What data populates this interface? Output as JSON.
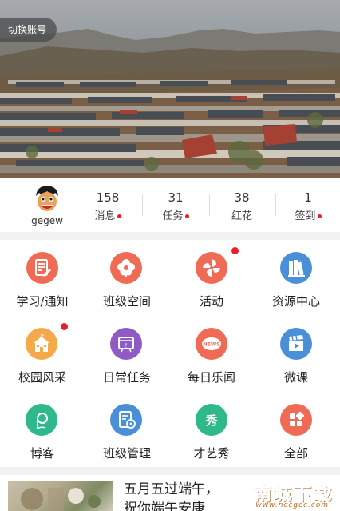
{
  "header": {
    "switch_account_label": "切换账号"
  },
  "profile": {
    "username": "gegew"
  },
  "stats": [
    {
      "count": "158",
      "label": "消息",
      "has_dot": true
    },
    {
      "count": "31",
      "label": "任务",
      "has_dot": true
    },
    {
      "count": "38",
      "label": "红花",
      "has_dot": false
    },
    {
      "count": "1",
      "label": "签到",
      "has_dot": true
    }
  ],
  "grid": {
    "items": [
      {
        "label": "学习/通知",
        "icon": "notice-icon",
        "color": "#f06b55",
        "badge": false
      },
      {
        "label": "班级空间",
        "icon": "flower-icon",
        "color": "#f06b55",
        "badge": false
      },
      {
        "label": "活动",
        "icon": "pinwheel-icon",
        "color": "#f06b55",
        "badge": true
      },
      {
        "label": "资源中心",
        "icon": "books-icon",
        "color": "#4a90d9",
        "badge": false
      },
      {
        "label": "校园风采",
        "icon": "school-icon",
        "color": "#f5a94a",
        "badge": true
      },
      {
        "label": "日常任务",
        "icon": "task-icon",
        "color": "#8e5bc4",
        "badge": false
      },
      {
        "label": "每日乐闻",
        "icon": "news-icon",
        "color": "#f06b55",
        "badge": false,
        "icon_text": "NEWS"
      },
      {
        "label": "微课",
        "icon": "video-icon",
        "color": "#4a90d9",
        "badge": false
      },
      {
        "label": "博客",
        "icon": "blog-icon",
        "color": "#2fb98a",
        "badge": false
      },
      {
        "label": "班级管理",
        "icon": "manage-icon",
        "color": "#4a90d9",
        "badge": false
      },
      {
        "label": "才艺秀",
        "icon": "talent-icon",
        "color": "#2fb98a",
        "badge": false,
        "icon_text": "秀"
      },
      {
        "label": "全部",
        "icon": "all-icon",
        "color": "#f06b55",
        "badge": false
      }
    ]
  },
  "news": {
    "title_line1": "五月五过端午，",
    "title_line2": "祝你端午安康"
  },
  "watermark": {
    "name": "南城下载",
    "url": "www.nccgcc.com"
  }
}
